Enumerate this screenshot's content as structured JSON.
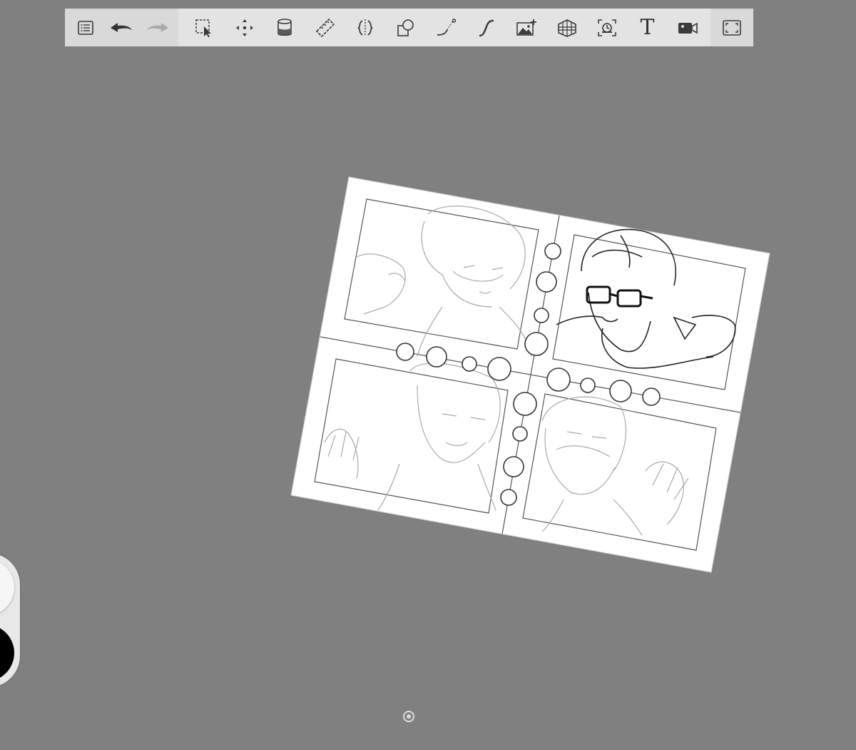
{
  "app": {
    "background_color": "#808080",
    "toolbar_color": "#e3e3e3",
    "toolbar_group_color": "#d9d9d9",
    "icon_color": "#3a3a3a",
    "icon_disabled_color": "#a8a8a8"
  },
  "toolbar": {
    "text_tool_glyph": "T",
    "left_tools": [
      {
        "icon": "list-icon",
        "enabled": true
      },
      {
        "icon": "undo-icon",
        "enabled": true
      },
      {
        "icon": "redo-icon",
        "enabled": false
      }
    ],
    "middle_tools": [
      {
        "icon": "selection-icon"
      },
      {
        "icon": "transform-icon"
      },
      {
        "icon": "fill-icon"
      },
      {
        "icon": "ruler-icon"
      },
      {
        "icon": "symmetry-icon"
      },
      {
        "icon": "shape-icon"
      },
      {
        "icon": "curve-icon"
      },
      {
        "icon": "stroke-icon"
      },
      {
        "icon": "image-add-icon"
      },
      {
        "icon": "perspective-icon"
      },
      {
        "icon": "time-lapse-icon"
      },
      {
        "icon": "text-icon"
      },
      {
        "icon": "video-icon"
      }
    ],
    "right_tools": [
      {
        "icon": "fullscreen-icon"
      }
    ]
  },
  "canvas": {
    "paper_color": "#ffffff",
    "line_color": "#555555",
    "panels": 4,
    "description_free": true
  },
  "color_puck": {
    "primary_color": "#000000",
    "secondary_color": "#f6f6f6"
  }
}
